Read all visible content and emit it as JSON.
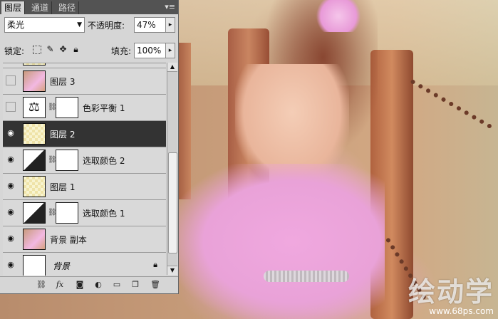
{
  "panel": {
    "tabs": [
      {
        "label": "图层",
        "active": true
      },
      {
        "label": "通道",
        "active": false
      },
      {
        "label": "路径",
        "active": false
      }
    ],
    "menu_icon": "▾≡"
  },
  "blend": {
    "mode": "柔光",
    "opacity_label": "不透明度:",
    "opacity_value": "47%"
  },
  "lock": {
    "label": "锁定:",
    "fill_label": "填充:",
    "fill_value": "100%",
    "icons": [
      "lock-transparent-icon",
      "lock-paint-icon",
      "lock-move-icon",
      "lock-all-icon"
    ]
  },
  "layers": [
    {
      "name": "图层 3",
      "visible": false,
      "thumb": "photo",
      "mask": false
    },
    {
      "name": "色彩平衡 1",
      "visible": false,
      "thumb": "adj-balance",
      "mask": true
    },
    {
      "name": "图层 2",
      "visible": true,
      "thumb": "checker",
      "mask": false,
      "selected": true
    },
    {
      "name": "选取颜色 2",
      "visible": true,
      "thumb": "adj-select",
      "mask": true
    },
    {
      "name": "图层 1",
      "visible": true,
      "thumb": "checker",
      "mask": false
    },
    {
      "name": "选取颜色 1",
      "visible": true,
      "thumb": "adj-select",
      "mask": true
    },
    {
      "name": "背景 副本",
      "visible": true,
      "thumb": "photo",
      "mask": false
    },
    {
      "name": "背景",
      "visible": true,
      "thumb": "white",
      "mask": false,
      "locked": true
    }
  ],
  "bottom_icons": [
    "link-icon",
    "fx-icon",
    "mask-icon",
    "adjustment-icon",
    "group-icon",
    "new-layer-icon",
    "trash-icon"
  ],
  "watermark": {
    "logo": "绘动学",
    "url": "www.68ps.com"
  }
}
